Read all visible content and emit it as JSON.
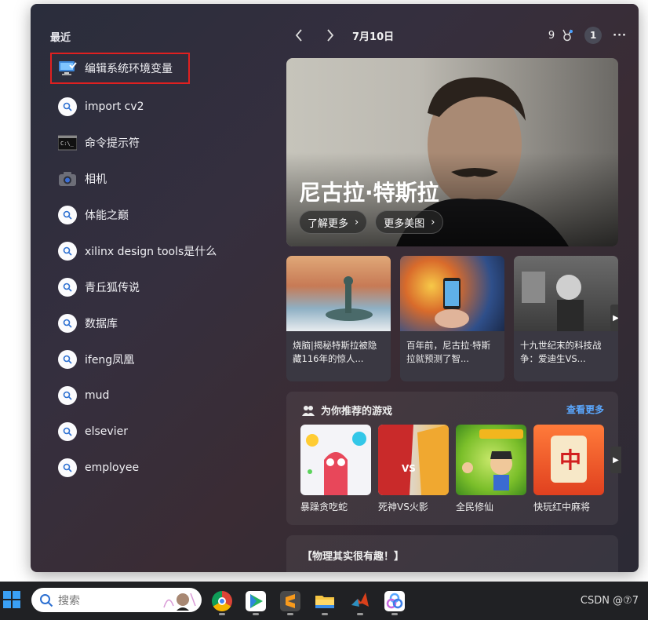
{
  "recent": {
    "title": "最近",
    "items": [
      {
        "label": "编辑系统环境变量",
        "icon": "monitor-settings-icon"
      },
      {
        "label": "import cv2",
        "icon": "search-icon"
      },
      {
        "label": "命令提示符",
        "icon": "terminal-icon"
      },
      {
        "label": "相机",
        "icon": "camera-icon"
      },
      {
        "label": "体能之巅",
        "icon": "search-icon"
      },
      {
        "label": "xilinx design tools是什么",
        "icon": "search-icon"
      },
      {
        "label": "青丘狐传说",
        "icon": "search-icon"
      },
      {
        "label": "数据库",
        "icon": "search-icon"
      },
      {
        "label": "ifeng凤凰",
        "icon": "search-icon"
      },
      {
        "label": "mud",
        "icon": "search-icon"
      },
      {
        "label": "elsevier",
        "icon": "search-icon"
      },
      {
        "label": "employee",
        "icon": "search-icon"
      }
    ]
  },
  "topbar": {
    "date": "7月10日",
    "points": "9",
    "notification_count": "1",
    "more": "···"
  },
  "hero": {
    "title": "尼古拉·特斯拉",
    "learn_more": "了解更多",
    "more_images": "更多美图"
  },
  "cards": [
    {
      "text": "烧脑|揭秘特斯拉被隐藏116年的惊人..."
    },
    {
      "text": "百年前，尼古拉·特斯拉就预测了智..."
    },
    {
      "text": "十九世纪末的科技战争：爱迪生VS..."
    }
  ],
  "games": {
    "title": "为你推荐的游戏",
    "more": "查看更多",
    "items": [
      {
        "name": "暴躁贪吃蛇"
      },
      {
        "name": "死神VS火影"
      },
      {
        "name": "全民修仙"
      },
      {
        "name": "快玩红中麻将"
      }
    ]
  },
  "fact": {
    "title": "【物理其实很有趣！】"
  },
  "taskbar": {
    "search_placeholder": "搜索",
    "watermark": "CSDN @⑦7"
  },
  "colors": {
    "highlight_border": "#e02020",
    "link_blue": "#5aa8ff",
    "taskbar_bg": "#202124"
  }
}
